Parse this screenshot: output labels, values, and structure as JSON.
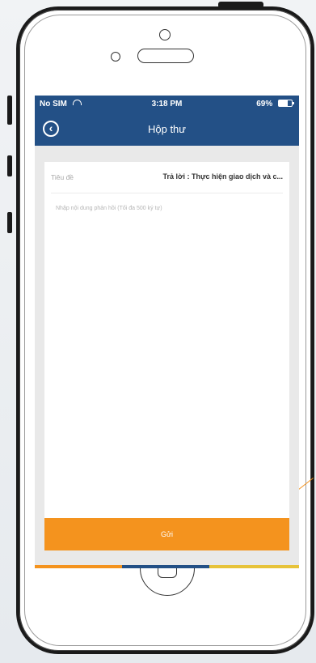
{
  "status_bar": {
    "carrier": "No SIM",
    "time": "3:18 PM",
    "battery": "69%",
    "wifi_icon": "wifi-icon",
    "battery_icon": "battery-icon"
  },
  "header": {
    "title": "Hộp thư",
    "back_icon": "back-circle-icon"
  },
  "form": {
    "subject_label": "Tiêu đề",
    "subject_value": "Trả lời : Thực hiện giao dịch và c...",
    "message_placeholder": "Nhập nội dung phản hồi (Tối đa 500 ký tự)",
    "message_value": ""
  },
  "actions": {
    "send_label": "Gửi"
  },
  "colors": {
    "header_bg": "#235086",
    "send_button": "#f4931e",
    "background": "#e9e9e9"
  }
}
